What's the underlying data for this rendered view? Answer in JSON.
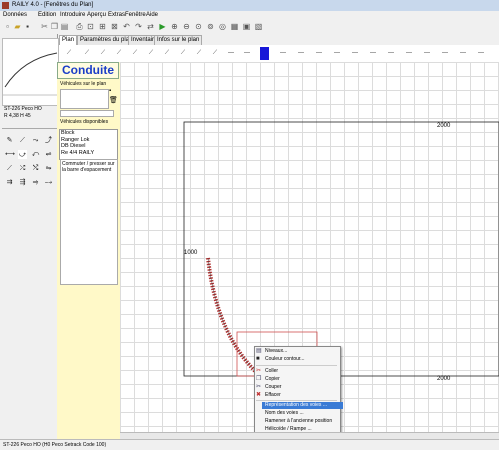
{
  "window": {
    "title": "RAILY 4.0 - [Fenêtres du Plan]"
  },
  "menu": [
    "Données",
    "Edition",
    "Introduire",
    "Aperçu",
    "Extras",
    "Fenêtre",
    "Aide"
  ],
  "tabs": [
    "Plan",
    "Paramètres du plan",
    "Inventaire",
    "Infos sur le plan"
  ],
  "left": {
    "part_name": "ST-226 Peco HO",
    "part_sub": "R 4,38 H 45"
  },
  "conduite": {
    "title": "Conduite",
    "on_plan_label": "Véhicules sur le plan",
    "available_label": "Véhicules disponibles",
    "vehicles": [
      "Block",
      "Ranger Lok",
      "DB Diesel",
      "Re 4/4 RAILY"
    ],
    "hint": "Commuter / presser sur la barre d'espacement"
  },
  "canvas": {
    "dim_top": "2000",
    "dim_bottom": "2000",
    "dim_left": "1000"
  },
  "context_menu": [
    {
      "label": "Niveaux..."
    },
    {
      "label": "Couleur contour..."
    },
    {
      "label": "Coller"
    },
    {
      "label": "Copier"
    },
    {
      "label": "Couper"
    },
    {
      "label": "Effacer"
    },
    {
      "label": "Représentation des voies ..."
    },
    {
      "label": "Nom des voies ..."
    },
    {
      "label": "Ramener à l'ancienne position"
    },
    {
      "label": "Hélicoïde / Rampe ..."
    }
  ],
  "status": {
    "text": "ST-226 Peco HO (H0 Peco Setrack Code 100)"
  },
  "colors": {
    "accent": "#1a3dc8",
    "highlight": "#3a7bd5",
    "track": "#b03030",
    "panel": "#fff9c8"
  }
}
